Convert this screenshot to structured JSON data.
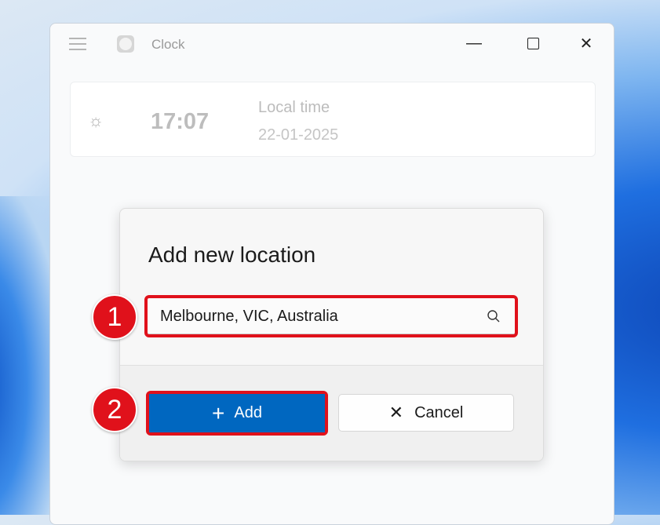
{
  "window": {
    "title": "Clock",
    "icon": "clock-icon",
    "controls": [
      "minimize",
      "maximize",
      "close"
    ]
  },
  "local_card": {
    "icon": "sun-icon",
    "time": "17:07",
    "label": "Local time",
    "date": "22-01-2025"
  },
  "dialog": {
    "title": "Add new location",
    "search_value": "Melbourne, VIC, Australia",
    "add_label": "Add",
    "cancel_label": "Cancel"
  },
  "annotations": {
    "step1": "1",
    "step2": "2",
    "color": "#e0111b"
  },
  "colors": {
    "accent": "#0067c0"
  }
}
